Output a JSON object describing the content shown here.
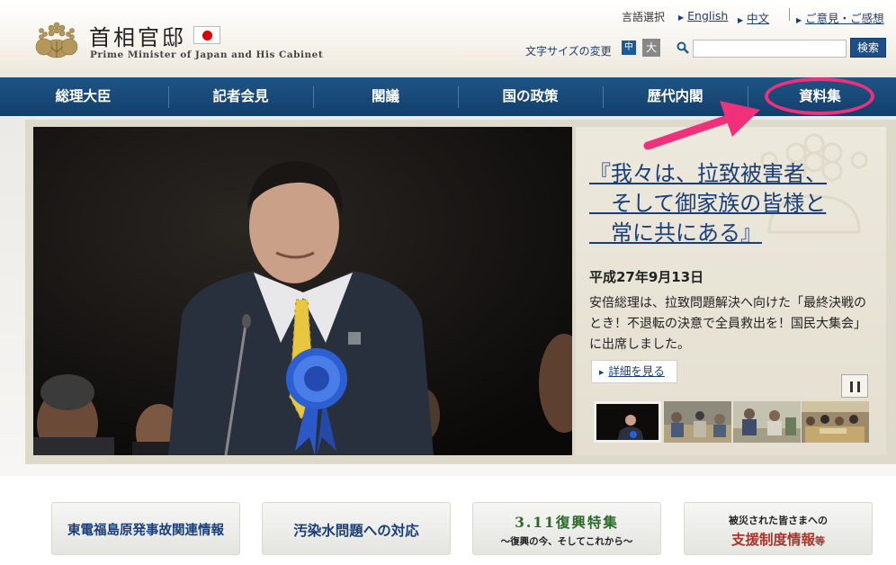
{
  "header": {
    "title": "首相官邸",
    "subtitle": "Prime Minister of Japan and His Cabinet",
    "language_label": "言語選択",
    "lang_english": "English",
    "lang_chinese": "中文",
    "feedback_link": "ご意見・ご感想",
    "font_size_label": "文字サイズの変更",
    "font_size_medium": "中",
    "font_size_large": "大",
    "search_placeholder": "",
    "search_button": "検索"
  },
  "nav": {
    "items": [
      {
        "label": "総理大臣"
      },
      {
        "label": "記者会見"
      },
      {
        "label": "閣議"
      },
      {
        "label": "国の政策"
      },
      {
        "label": "歴代内閣"
      },
      {
        "label": "資料集"
      }
    ]
  },
  "feature": {
    "title": "『我々は、拉致被害者、\n　そして御家族の皆様と\n　常に共にある』",
    "date": "平成27年9月13日",
    "text": "安倍総理は、拉致問題解決へ向けた「最終決戦のとき！不退転の決意で全員救出を！国民大集会」に出席しました。",
    "detail_button": "詳細を見る"
  },
  "bottom_links": [
    {
      "label": "東電福島原発事故関連情報"
    },
    {
      "label": "汚染水問題への対応"
    },
    {
      "label": "3.11復興特集",
      "sub": "〜復興の今、そしてこれから〜"
    },
    {
      "label_top": "被災された皆さまへの",
      "label": "支援制度情報",
      "suffix": "等"
    }
  ],
  "colors": {
    "nav_bg": "#1f5486",
    "link": "#1a3e7a",
    "annotation": "#f0307a",
    "recovery_green": "#2c6b2a",
    "support_red": "#b0332a"
  }
}
